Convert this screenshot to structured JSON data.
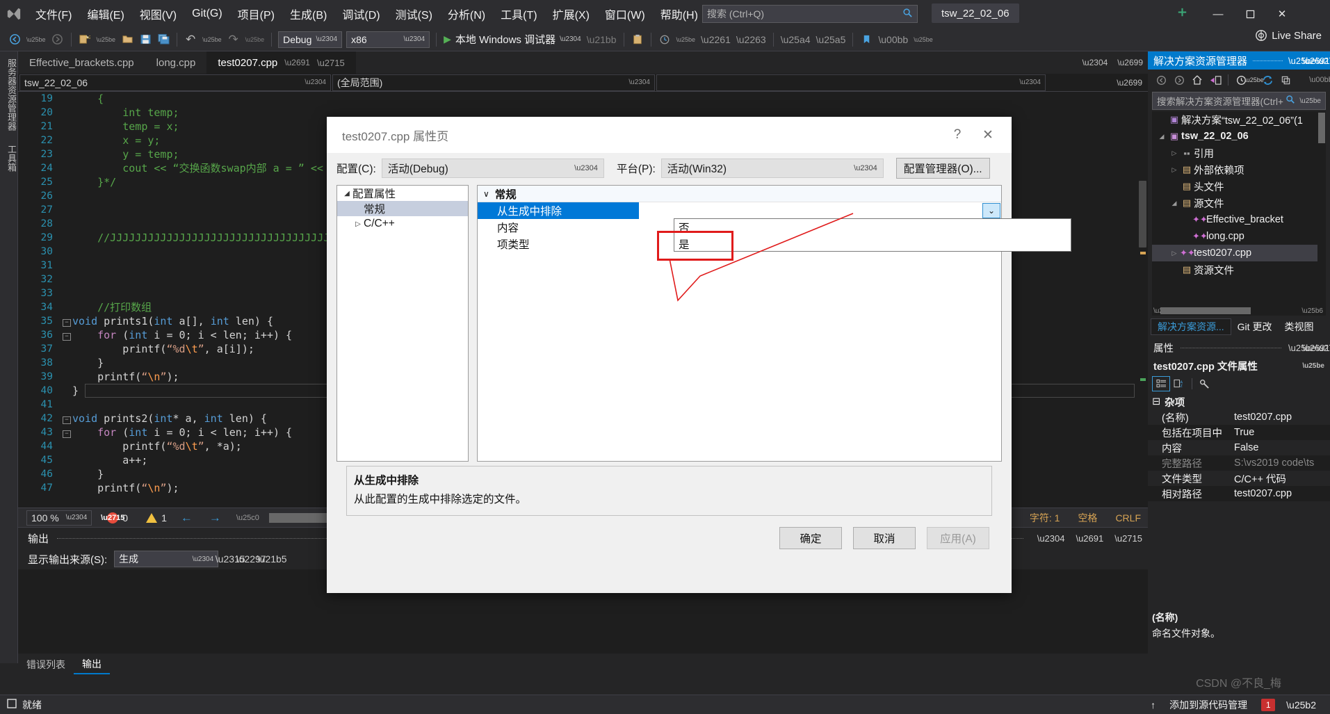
{
  "titlebar": {
    "logo_icon": "visual-studio-logo",
    "menus": [
      {
        "label": "文件(F)"
      },
      {
        "label": "编辑(E)"
      },
      {
        "label": "视图(V)"
      },
      {
        "label": "Git(G)"
      },
      {
        "label": "项目(P)"
      },
      {
        "label": "生成(B)"
      },
      {
        "label": "调试(D)"
      },
      {
        "label": "测试(S)"
      },
      {
        "label": "分析(N)"
      },
      {
        "label": "工具(T)"
      },
      {
        "label": "扩展(X)"
      },
      {
        "label": "窗口(W)"
      },
      {
        "label": "帮助(H)"
      }
    ],
    "search_placeholder": "搜索 (Ctrl+Q)",
    "project_chip": "tsw_22_02_06",
    "minimize": "—",
    "maximize": "☐",
    "close": "✕"
  },
  "toolbar": {
    "back": "←",
    "forward": "→",
    "new_item": "✦",
    "open": "▤",
    "save": "Ὃe",
    "save_all": "▥",
    "undo": "↶",
    "redo": "↷",
    "config": "Debug",
    "platform": "x86",
    "run_label": "本地 Windows 调试器",
    "run_glyph": "▶",
    "live_share": "Live Share",
    "live_share_icon": "live-share-icon"
  },
  "leftrail": {
    "items": [
      "服务器资源管理器",
      "工具箱"
    ]
  },
  "tabs": {
    "items": [
      {
        "label": "Effective_brackets.cpp",
        "active": false
      },
      {
        "label": "long.cpp",
        "active": false
      },
      {
        "label": "test0207.cpp",
        "active": true
      }
    ],
    "pin_icon": "pin-icon",
    "close_icon": "close-icon",
    "overflow_icon": "chevron-down-icon",
    "settings_icon": "gear-icon"
  },
  "navbar": {
    "project_scope": "tsw_22_02_06",
    "member_scope": "(全局范围)",
    "chevron": "⌄"
  },
  "editor": {
    "lines": [
      {
        "n": "19",
        "fold": "",
        "segs": [
          {
            "t": "    ",
            "c": ""
          },
          {
            "t": "{",
            "c": "k-green"
          }
        ]
      },
      {
        "n": "20",
        "fold": "",
        "segs": [
          {
            "t": "        ",
            "c": ""
          },
          {
            "t": "int",
            "c": "k-green"
          },
          {
            "t": " temp;",
            "c": "k-green"
          }
        ]
      },
      {
        "n": "21",
        "fold": "",
        "segs": [
          {
            "t": "        temp = x;",
            "c": "k-green"
          }
        ]
      },
      {
        "n": "22",
        "fold": "",
        "segs": [
          {
            "t": "        x = y;",
            "c": "k-green"
          }
        ]
      },
      {
        "n": "23",
        "fold": "",
        "segs": [
          {
            "t": "        y = temp;",
            "c": "k-green"
          }
        ]
      },
      {
        "n": "24",
        "fold": "",
        "segs": [
          {
            "t": "        cout << “交换函数swap内部 a = ” << &",
            "c": "k-green"
          }
        ]
      },
      {
        "n": "25",
        "fold": "",
        "segs": [
          {
            "t": "    }*/",
            "c": "k-green"
          }
        ]
      },
      {
        "n": "26",
        "fold": "",
        "segs": []
      },
      {
        "n": "27",
        "fold": "",
        "segs": []
      },
      {
        "n": "28",
        "fold": "",
        "segs": []
      },
      {
        "n": "29",
        "fold": "",
        "segs": [
          {
            "t": "    //JJJJJJJJJJJJJJJJJJJJJJJJJJJJJJJJJJJJJJJJJJJJJJJJJJJJJJJJJJJJJJJJJJJJJJJJJJJJJJJJJJJJJJJJJJJJJJ",
            "c": "k-green"
          }
        ]
      },
      {
        "n": "30",
        "fold": "",
        "segs": []
      },
      {
        "n": "31",
        "fold": "",
        "segs": []
      },
      {
        "n": "32",
        "fold": "",
        "segs": []
      },
      {
        "n": "33",
        "fold": "",
        "segs": []
      },
      {
        "n": "34",
        "fold": "",
        "segs": [
          {
            "t": "    //打印数组",
            "c": "k-green"
          }
        ]
      },
      {
        "n": "35",
        "fold": "-",
        "segs": [
          {
            "t": "void ",
            "c": "k-blue"
          },
          {
            "t": "prints1",
            "c": "ctext"
          },
          {
            "t": "(",
            "c": "ctext"
          },
          {
            "t": "int",
            "c": "k-blue"
          },
          {
            "t": " a[], ",
            "c": "ctext"
          },
          {
            "t": "int",
            "c": "k-blue"
          },
          {
            "t": " len) {",
            "c": "ctext"
          }
        ]
      },
      {
        "n": "36",
        "fold": "-",
        "segs": [
          {
            "t": "    ",
            "c": ""
          },
          {
            "t": "for",
            "c": "k-purple"
          },
          {
            "t": " (",
            "c": "ctext"
          },
          {
            "t": "int",
            "c": "k-blue"
          },
          {
            "t": " i = 0; i < len; i++) {",
            "c": "ctext"
          }
        ]
      },
      {
        "n": "37",
        "fold": "",
        "segs": [
          {
            "t": "        printf(",
            "c": "ctext"
          },
          {
            "t": "“%d",
            "c": "k-string"
          },
          {
            "t": "\\t",
            "c": "k-esc"
          },
          {
            "t": "”",
            "c": "k-string"
          },
          {
            "t": ", a[i]);",
            "c": "ctext"
          }
        ]
      },
      {
        "n": "38",
        "fold": "",
        "segs": [
          {
            "t": "    }",
            "c": "ctext"
          }
        ]
      },
      {
        "n": "39",
        "fold": "",
        "segs": [
          {
            "t": "    printf(",
            "c": "ctext"
          },
          {
            "t": "“",
            "c": "k-string"
          },
          {
            "t": "\\n",
            "c": "k-esc"
          },
          {
            "t": "”",
            "c": "k-string"
          },
          {
            "t": ");",
            "c": "ctext"
          }
        ]
      },
      {
        "n": "40",
        "fold": "",
        "segs": [
          {
            "t": "}",
            "c": "ctext"
          }
        ]
      },
      {
        "n": "41",
        "fold": "",
        "segs": []
      },
      {
        "n": "42",
        "fold": "-",
        "segs": [
          {
            "t": "void ",
            "c": "k-blue"
          },
          {
            "t": "prints2",
            "c": "ctext"
          },
          {
            "t": "(",
            "c": "ctext"
          },
          {
            "t": "int",
            "c": "k-blue"
          },
          {
            "t": "* a, ",
            "c": "ctext"
          },
          {
            "t": "int",
            "c": "k-blue"
          },
          {
            "t": " len) {",
            "c": "ctext"
          }
        ]
      },
      {
        "n": "43",
        "fold": "-",
        "segs": [
          {
            "t": "    ",
            "c": ""
          },
          {
            "t": "for",
            "c": "k-purple"
          },
          {
            "t": " (",
            "c": "ctext"
          },
          {
            "t": "int",
            "c": "k-blue"
          },
          {
            "t": " i = 0; i < len; i++) {",
            "c": "ctext"
          }
        ]
      },
      {
        "n": "44",
        "fold": "",
        "segs": [
          {
            "t": "        printf(",
            "c": "ctext"
          },
          {
            "t": "“%d",
            "c": "k-string"
          },
          {
            "t": "\\t",
            "c": "k-esc"
          },
          {
            "t": "”",
            "c": "k-string"
          },
          {
            "t": ", *a);",
            "c": "ctext"
          }
        ]
      },
      {
        "n": "45",
        "fold": "",
        "segs": [
          {
            "t": "        a++;",
            "c": "ctext"
          }
        ]
      },
      {
        "n": "46",
        "fold": "",
        "segs": [
          {
            "t": "    }",
            "c": "ctext"
          }
        ]
      },
      {
        "n": "47",
        "fold": "",
        "segs": [
          {
            "t": "    printf(",
            "c": "ctext"
          },
          {
            "t": "“",
            "c": "k-string"
          },
          {
            "t": "\\n",
            "c": "k-esc"
          },
          {
            "t": "”",
            "c": "k-string"
          },
          {
            "t": ");",
            "c": "ctext"
          }
        ]
      }
    ],
    "current_line_index": 21
  },
  "editor_status": {
    "zoom": "100 %",
    "zoom_chevron": "⌄",
    "errors": "0",
    "warnings": "1",
    "prev_arrow": "←",
    "next_arrow": "→",
    "line_label": "1",
    "char_label": "字符: 1",
    "space_label": "空格",
    "eol_label": "CRLF"
  },
  "output": {
    "title": "输出",
    "source_label": "显示输出来源(S):",
    "source_value": "生成",
    "tabs": [
      {
        "label": "错误列表",
        "active": false
      },
      {
        "label": "输出",
        "active": true
      }
    ],
    "hdr_icons": [
      "chevron-down-icon",
      "pin-icon",
      "close-icon"
    ]
  },
  "solution_explorer": {
    "title": "解决方案资源管理器",
    "pt_icons": [
      "chevron-down-icon",
      "pin-icon",
      "close-icon"
    ],
    "toolbar_icons": [
      "back-icon",
      "forward-icon",
      "home-icon",
      "switch-view-icon",
      "pending-changes-icon",
      "refresh-icon",
      "collapse-all-icon"
    ],
    "search_placeholder": "搜索解决方案资源管理器(Ctrl+",
    "search_icon": "search-icon",
    "search_chevron": "chevron-down-icon",
    "tree": [
      {
        "indent": 0,
        "arrow": "",
        "icon": "solution-icon",
        "icon_color": "#b084d6",
        "label": "解决方案“tsw_22_02_06”(1",
        "bold": false,
        "selected": false
      },
      {
        "indent": 0,
        "arrow": "◢",
        "icon": "project-icon",
        "icon_color": "#c98fd9",
        "label": "tsw_22_02_06",
        "bold": true,
        "selected": false
      },
      {
        "indent": 1,
        "arrow": "▷",
        "icon": "references-icon",
        "icon_color": "#a0a0a0",
        "label": "引用",
        "bold": false,
        "selected": false
      },
      {
        "indent": 1,
        "arrow": "▷",
        "icon": "ext-deps-icon",
        "icon_color": "#dcb67a",
        "label": "外部依赖项",
        "bold": false,
        "selected": false
      },
      {
        "indent": 1,
        "arrow": "",
        "icon": "filter-folder-icon",
        "icon_color": "#dcb67a",
        "label": "头文件",
        "bold": false,
        "selected": false
      },
      {
        "indent": 1,
        "arrow": "◢",
        "icon": "filter-folder-icon",
        "icon_color": "#dcb67a",
        "label": "源文件",
        "bold": false,
        "selected": false
      },
      {
        "indent": 2,
        "arrow": "",
        "icon": "cpp-file-icon",
        "icon_color": "#cf6fd4",
        "label": "Effective_bracket",
        "bold": false,
        "selected": false
      },
      {
        "indent": 2,
        "arrow": "",
        "icon": "cpp-file-icon",
        "icon_color": "#cf6fd4",
        "label": "long.cpp",
        "bold": false,
        "selected": false
      },
      {
        "indent": 1,
        "arrow": "▷",
        "icon": "cpp-file-icon",
        "icon_color": "#cf6fd4",
        "label": "test0207.cpp",
        "bold": false,
        "selected": true
      },
      {
        "indent": 1,
        "arrow": "",
        "icon": "filter-folder-icon",
        "icon_color": "#dcb67a",
        "label": "资源文件",
        "bold": false,
        "selected": false
      }
    ],
    "dock_tabs": [
      {
        "label": "解决方案资源...",
        "active": true
      },
      {
        "label": "Git 更改",
        "active": false
      },
      {
        "label": "类视图",
        "active": false
      }
    ]
  },
  "properties_panel": {
    "title": "属性",
    "pt_icons": [
      "chevron-down-icon",
      "pin-icon",
      "close-icon"
    ],
    "object_name": "test0207.cpp 文件属性",
    "object_chevron": "chevron-down-icon",
    "toolbar_icons": [
      "categorized-icon",
      "alphabetical-icon",
      "property-pages-icon"
    ],
    "category": "杂项",
    "category_glyph": "⊟",
    "rows": [
      {
        "key": "(名称)",
        "value": "test0207.cpp",
        "dim": false
      },
      {
        "key": "包括在项目中",
        "value": "True",
        "dim": false
      },
      {
        "key": "内容",
        "value": "False",
        "dim": false
      },
      {
        "key": "完整路径",
        "value": "S:\\vs2019 code\\ts",
        "dim": true
      },
      {
        "key": "文件类型",
        "value": "C/C++ 代码",
        "dim": false
      },
      {
        "key": "相对路径",
        "value": "test0207.cpp",
        "dim": false
      }
    ],
    "desc_title": "(名称)",
    "desc_body": "命名文件对象。"
  },
  "statusbar": {
    "ready": "就绪",
    "ready_icon": "stop-icon",
    "add_to_source_control": "添加到源代码管理",
    "up_arrow": "↑",
    "badge": "1",
    "bell_icon": "bell-icon"
  },
  "watermark": "CSDN @不良_梅",
  "dialog": {
    "title": "test0207.cpp 属性页",
    "help_icon": "?",
    "close_icon": "✕",
    "config_label": "配置(C):",
    "config_value": "活动(Debug)",
    "platform_label": "平台(P):",
    "platform_value": "活动(Win32)",
    "config_manager_button": "配置管理器(O)...",
    "tree": [
      {
        "indent": 0,
        "arrow": "◢",
        "label": "配置属性",
        "selected": false
      },
      {
        "indent": 1,
        "arrow": "",
        "label": "常规",
        "selected": true
      },
      {
        "indent": 1,
        "arrow": "▷",
        "label": "C/C++",
        "selected": false
      }
    ],
    "section_title": "常规",
    "section_chevron": "∨",
    "rows": [
      {
        "key": "从生成中排除",
        "value": "",
        "selected": true
      },
      {
        "key": "内容",
        "value": "",
        "selected": false
      },
      {
        "key": "项类型",
        "value": "",
        "selected": false
      }
    ],
    "dropdown_options": [
      {
        "label": "否",
        "highlighted": false
      },
      {
        "label": "是",
        "highlighted": true
      }
    ],
    "dropdown_chevron": "⌄",
    "desc_title": "从生成中排除",
    "desc_body": "从此配置的生成中排除选定的文件。",
    "buttons": [
      {
        "label": "确定",
        "disabled": false
      },
      {
        "label": "取消",
        "disabled": false
      },
      {
        "label": "应用(A)",
        "disabled": true
      }
    ],
    "annotation_color": "#e01b1b"
  }
}
